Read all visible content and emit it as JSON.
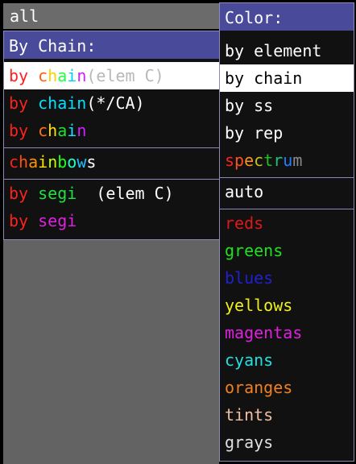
{
  "header": {
    "label": "all"
  },
  "chain_menu": {
    "title": "By Chain:",
    "items": [
      {
        "parts": [
          [
            "by ",
            "#ff2020"
          ],
          [
            "c",
            "#ff6010"
          ],
          [
            "h",
            "#ffd000"
          ],
          [
            "a",
            "#20ff40"
          ],
          [
            "i",
            "#00d0ff"
          ],
          [
            "n",
            "#d020ff"
          ],
          [
            "(elem C)",
            "#b8b8b8"
          ]
        ],
        "selected": true
      },
      {
        "parts": [
          [
            "by ",
            "#ff2020"
          ],
          [
            "chain",
            "#00e0ff"
          ],
          [
            "(*/CA)",
            "#ffffff"
          ]
        ]
      },
      {
        "parts": [
          [
            "by ",
            "#ff2020"
          ],
          [
            "c",
            "#ff7010"
          ],
          [
            "h",
            "#ffe000"
          ],
          [
            "a",
            "#20e030"
          ],
          [
            "i",
            "#20e0ff"
          ],
          [
            "n",
            "#d020ff"
          ]
        ]
      },
      {
        "parts": [
          [
            "c",
            "#ff2020"
          ],
          [
            "h",
            "#ff5010"
          ],
          [
            "a",
            "#ff9000"
          ],
          [
            "i",
            "#ffe000"
          ],
          [
            "n",
            "#c0ff00"
          ],
          [
            "b",
            "#20ff20"
          ],
          [
            "o",
            "#20ffc0"
          ],
          [
            "w",
            "#20c0ff"
          ],
          [
            "s",
            "#ffffff"
          ]
        ]
      },
      {
        "parts": [
          [
            "by ",
            "#ff2020"
          ],
          [
            "segi",
            "#20e040"
          ],
          [
            "  (elem C)",
            "#ffffff"
          ]
        ]
      },
      {
        "parts": [
          [
            "by ",
            "#ff2020"
          ],
          [
            "segi",
            "#e020e0"
          ]
        ]
      }
    ]
  },
  "color_menu": {
    "title": "Color:",
    "items": [
      {
        "parts": [
          [
            "by element",
            "#ffffff"
          ]
        ]
      },
      {
        "parts": [
          [
            "by chain",
            "#000000"
          ]
        ],
        "selected": true
      },
      {
        "parts": [
          [
            "by ss",
            "#ffffff"
          ]
        ]
      },
      {
        "parts": [
          [
            "by rep",
            "#ffffff"
          ]
        ]
      },
      {
        "parts": [
          [
            "s",
            "#ff2020"
          ],
          [
            "p",
            "#ff5020"
          ],
          [
            "e",
            "#ff9020"
          ],
          [
            "c",
            "#c0c020"
          ],
          [
            "t",
            "#20c020"
          ],
          [
            "r",
            "#20c080"
          ],
          [
            "u",
            "#2080ff"
          ],
          [
            "m",
            "#8a8a8a"
          ]
        ]
      },
      {
        "parts": [
          [
            "auto",
            "#ffffff"
          ]
        ]
      },
      {
        "parts": [
          [
            "reds",
            "#e01818"
          ]
        ]
      },
      {
        "parts": [
          [
            "greens",
            "#20e020"
          ]
        ]
      },
      {
        "parts": [
          [
            "blues",
            "#2020d0"
          ]
        ]
      },
      {
        "parts": [
          [
            "yellows",
            "#f0f020"
          ]
        ]
      },
      {
        "parts": [
          [
            "magentas",
            "#e020e0"
          ]
        ]
      },
      {
        "parts": [
          [
            "cyans",
            "#20e0e0"
          ]
        ]
      },
      {
        "parts": [
          [
            "oranges",
            "#f08020"
          ]
        ]
      },
      {
        "parts": [
          [
            "tints",
            "#f0c0a0"
          ]
        ]
      },
      {
        "parts": [
          [
            "grays",
            "#e0e0e0"
          ]
        ]
      }
    ]
  }
}
